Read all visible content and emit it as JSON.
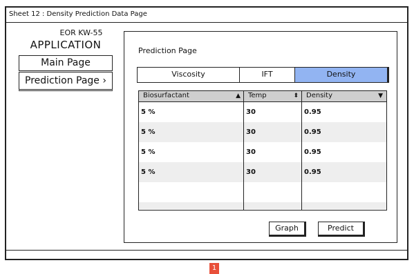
{
  "sheet_title": "Sheet 12 : Density Prediction Data Page",
  "sidebar": {
    "app_line1": "EOR KW-55",
    "app_line2": "APPLICATION",
    "main_page": "Main Page",
    "prediction_page": "Prediction Page ›"
  },
  "main": {
    "title": "Prediction Page",
    "tabs": [
      {
        "label": "Viscosity"
      },
      {
        "label": "IFT"
      },
      {
        "label": "Density",
        "selected": true
      }
    ],
    "table": {
      "columns": [
        {
          "label": "Biosurfactant",
          "sort": "▲"
        },
        {
          "label": "Temp",
          "sort": "⬍"
        },
        {
          "label": "Density",
          "sort": "▼"
        }
      ],
      "rows": [
        [
          "5 %",
          "30",
          "0.95"
        ],
        [
          "5 %",
          "30",
          "0.95"
        ],
        [
          "5 %",
          "30",
          "0.95"
        ],
        [
          "5 %",
          "30",
          "0.95"
        ],
        [
          "",
          "",
          ""
        ],
        [
          "",
          "",
          ""
        ]
      ]
    },
    "buttons": {
      "graph": "Graph",
      "predict": "Predict"
    }
  },
  "footer": {
    "page_number": "1"
  },
  "colors": {
    "selected_tab": "#92b4f2",
    "header_bg": "#cfcfcf",
    "alt_row": "#eeeeee",
    "badge": "#e8503a"
  }
}
